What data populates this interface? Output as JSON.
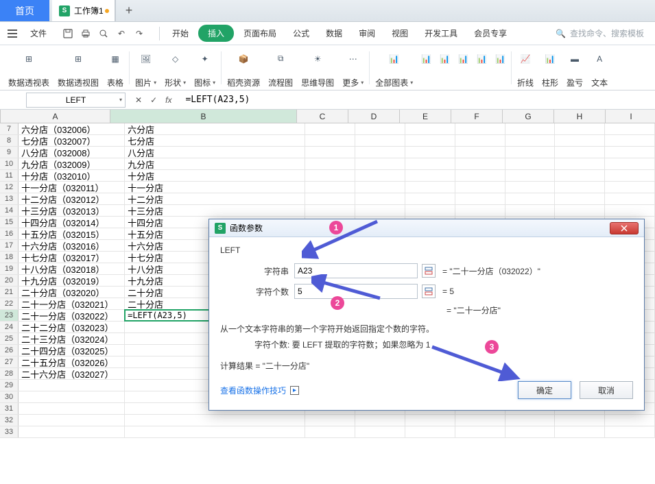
{
  "tabs": {
    "home": "首页",
    "workbook": "工作簿1"
  },
  "menu": {
    "file": "文件",
    "ribbon": [
      "开始",
      "插入",
      "页面布局",
      "公式",
      "数据",
      "审阅",
      "视图",
      "开发工具",
      "会员专享"
    ],
    "active": "插入",
    "search_placeholder": "查找命令、搜索模板"
  },
  "ribbon_groups": [
    "数据透视表",
    "数据透视图",
    "表格",
    "图片",
    "形状",
    "图标",
    "稻壳资源",
    "流程图",
    "思维导图",
    "更多",
    "全部图表",
    "",
    "",
    "",
    "",
    "",
    "折线",
    "柱形",
    "盈亏",
    "文本"
  ],
  "name_box": "LEFT",
  "formula": "=LEFT(A23,5)",
  "grid": {
    "col_labels": [
      "A",
      "B",
      "C",
      "D",
      "E",
      "F",
      "G",
      "H",
      "I"
    ],
    "active_row": 23,
    "active_col": "B",
    "rows": [
      {
        "n": 7,
        "a": "六分店（032006）",
        "b": "六分店"
      },
      {
        "n": 8,
        "a": "七分店（032007）",
        "b": "七分店"
      },
      {
        "n": 9,
        "a": "八分店（032008）",
        "b": "八分店"
      },
      {
        "n": 10,
        "a": "九分店（032009）",
        "b": "九分店"
      },
      {
        "n": 11,
        "a": "十分店（032010）",
        "b": "十分店"
      },
      {
        "n": 12,
        "a": "十一分店（032011）",
        "b": "十一分店"
      },
      {
        "n": 13,
        "a": "十二分店（032012）",
        "b": "十二分店"
      },
      {
        "n": 14,
        "a": "十三分店（032013）",
        "b": "十三分店"
      },
      {
        "n": 15,
        "a": "十四分店（032014）",
        "b": "十四分店"
      },
      {
        "n": 16,
        "a": "十五分店（032015）",
        "b": "十五分店"
      },
      {
        "n": 17,
        "a": "十六分店（032016）",
        "b": "十六分店"
      },
      {
        "n": 18,
        "a": "十七分店（032017）",
        "b": "十七分店"
      },
      {
        "n": 19,
        "a": "十八分店（032018）",
        "b": "十八分店"
      },
      {
        "n": 20,
        "a": "十九分店（032019）",
        "b": "十九分店"
      },
      {
        "n": 21,
        "a": "二十分店（032020）",
        "b": "二十分店"
      },
      {
        "n": 22,
        "a": "二十一分店（032021）",
        "b": "二十分店"
      },
      {
        "n": 23,
        "a": "二十一分店（032022）",
        "b": "=LEFT(A23,5)"
      },
      {
        "n": 24,
        "a": "二十二分店（032023）",
        "b": ""
      },
      {
        "n": 25,
        "a": "二十三分店（032024）",
        "b": ""
      },
      {
        "n": 26,
        "a": "二十四分店（032025）",
        "b": ""
      },
      {
        "n": 27,
        "a": "二十五分店（032026）",
        "b": ""
      },
      {
        "n": 28,
        "a": "二十六分店（032027）",
        "b": ""
      },
      {
        "n": 29,
        "a": "",
        "b": ""
      },
      {
        "n": 30,
        "a": "",
        "b": ""
      },
      {
        "n": 31,
        "a": "",
        "b": ""
      },
      {
        "n": 32,
        "a": "",
        "b": ""
      },
      {
        "n": 33,
        "a": "",
        "b": ""
      }
    ]
  },
  "dialog": {
    "title": "函数参数",
    "fn": "LEFT",
    "param1_label": "字符串",
    "param1_value": "A23",
    "param1_eval": "= \"二十一分店（032022）\"",
    "param2_label": "字符个数",
    "param2_value": "5",
    "param2_eval": "= 5",
    "result_eval": "= \"二十一分店\"",
    "fn_desc": "从一个文本字符串的第一个字符开始返回指定个数的字符。",
    "arg_desc": "字符个数: 要 LEFT 提取的字符数；如果忽略为 1",
    "calc_result": "计算结果 = \"二十一分店\"",
    "help": "查看函数操作技巧",
    "ok": "确定",
    "cancel": "取消"
  },
  "badges": [
    "1",
    "2",
    "3"
  ]
}
